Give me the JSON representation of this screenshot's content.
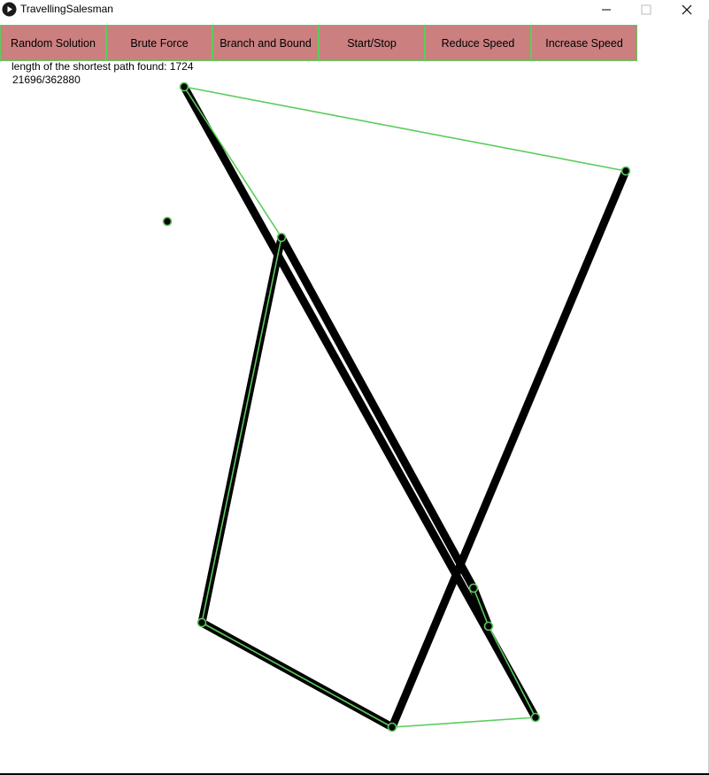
{
  "window": {
    "title": "TravellingSalesman",
    "icon": "play-icon",
    "controls": [
      "minimize-icon",
      "maximize-icon",
      "close-icon"
    ]
  },
  "toolbar": {
    "buttons": [
      {
        "label": "Random Solution"
      },
      {
        "label": "Brute Force"
      },
      {
        "label": "Branch and Bound"
      },
      {
        "label": "Start/Stop"
      },
      {
        "label": "Reduce Speed"
      },
      {
        "label": "Increase Speed"
      }
    ]
  },
  "info": {
    "shortest_path_label": "length of the shortest path found: 1724",
    "progress_label": "21696/362880"
  },
  "colors": {
    "button_fill": "#cb7f7f",
    "button_border": "#5ccc5c",
    "best_path": "#5ccc5c",
    "current_path": "#000000",
    "city_fill": "#000000",
    "city_stroke": "#5ccc5c"
  }
}
